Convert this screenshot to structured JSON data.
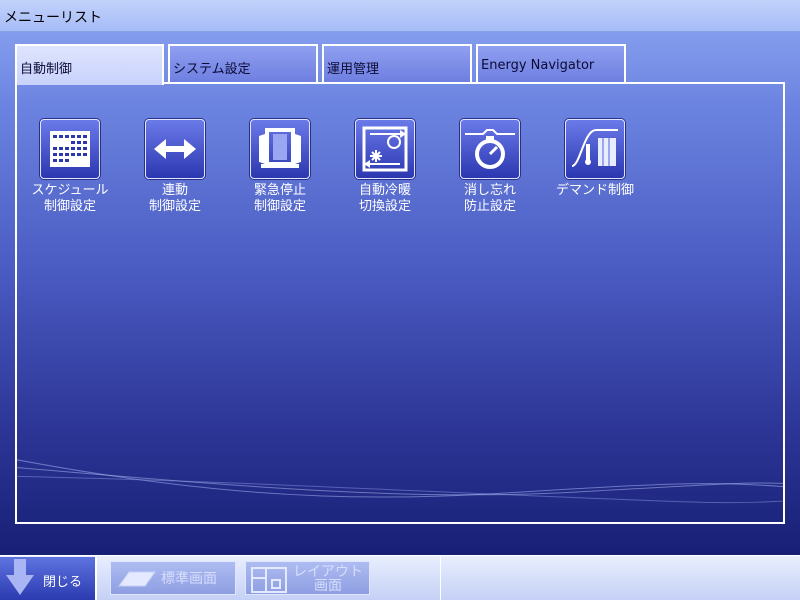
{
  "window": {
    "title": "メニューリスト"
  },
  "tabs": [
    {
      "label": "自動制御",
      "active": true
    },
    {
      "label": "システム設定",
      "active": false
    },
    {
      "label": "運用管理",
      "active": false
    },
    {
      "label": "Energy Navigator",
      "active": false
    }
  ],
  "menu_items": [
    {
      "label": "スケジュール\n制御設定",
      "icon": "calendar-icon"
    },
    {
      "label": "連動\n制御設定",
      "icon": "double-arrow-icon"
    },
    {
      "label": "緊急停止\n制御設定",
      "icon": "emergency-stop-icon"
    },
    {
      "label": "自動冷暖\n切換設定",
      "icon": "cool-heat-switch-icon"
    },
    {
      "label": "消し忘れ\n防止設定",
      "icon": "stopwatch-icon"
    },
    {
      "label": "デマンド制御",
      "icon": "demand-control-icon"
    }
  ],
  "bottom_bar": {
    "close_label": "閉じる",
    "standard_screen_label": "標準画面",
    "layout_screen_label": "レイアウト\n画面"
  },
  "colors": {
    "accent": "#2b37b0",
    "text_on_dark": "#ffffff",
    "disabled_text": "#d6defc"
  }
}
